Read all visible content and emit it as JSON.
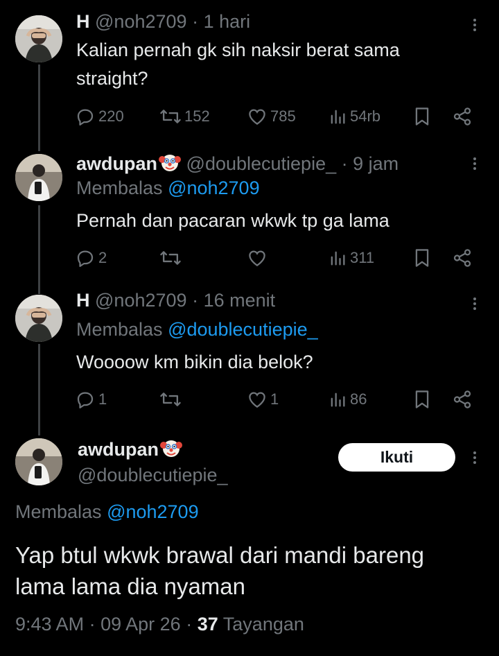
{
  "thread": [
    {
      "name": "H",
      "handle": "@noh2709",
      "time": "1 hari",
      "reply_prefix": "",
      "reply_to": "",
      "text": "Kalian pernah gk sih naksir berat sama straight?",
      "replies": "220",
      "retweets": "152",
      "likes": "785",
      "views": "54rb",
      "avatar": "person-covering-face"
    },
    {
      "name": "awdupan",
      "handle": "@doublecutiepie_",
      "time": "9 jam",
      "reply_prefix": "Membalas",
      "reply_to": "@noh2709",
      "text": "Pernah dan pacaran wkwk tp ga lama",
      "replies": "2",
      "retweets": "",
      "likes": "",
      "views": "311",
      "avatar": "mirror-selfie",
      "emoji": "clown-face"
    },
    {
      "name": "H",
      "handle": "@noh2709",
      "time": "16 menit",
      "reply_prefix": "Membalas",
      "reply_to": "@doublecutiepie_",
      "text": "Woooow km bikin dia belok?",
      "replies": "1",
      "retweets": "",
      "likes": "1",
      "views": "86",
      "avatar": "person-covering-face"
    }
  ],
  "main": {
    "name": "awdupan",
    "handle": "@doublecutiepie_",
    "follow_label": "Ikuti",
    "reply_prefix": "Membalas",
    "reply_to": "@noh2709",
    "text_line1": "Yap btul wkwk brawal dari mandi bareng",
    "text_line2": "lama lama dia nyaman",
    "time": "9:43 AM",
    "date": "09 Apr 26",
    "views_count": "37",
    "views_label": "Tayangan",
    "emoji": "clown-face"
  },
  "sep": "·",
  "colors": {
    "background": "#000000",
    "text": "#e7e9ea",
    "muted": "#71767b",
    "link": "#1d9bf0",
    "thread_line": "#3e4144"
  }
}
